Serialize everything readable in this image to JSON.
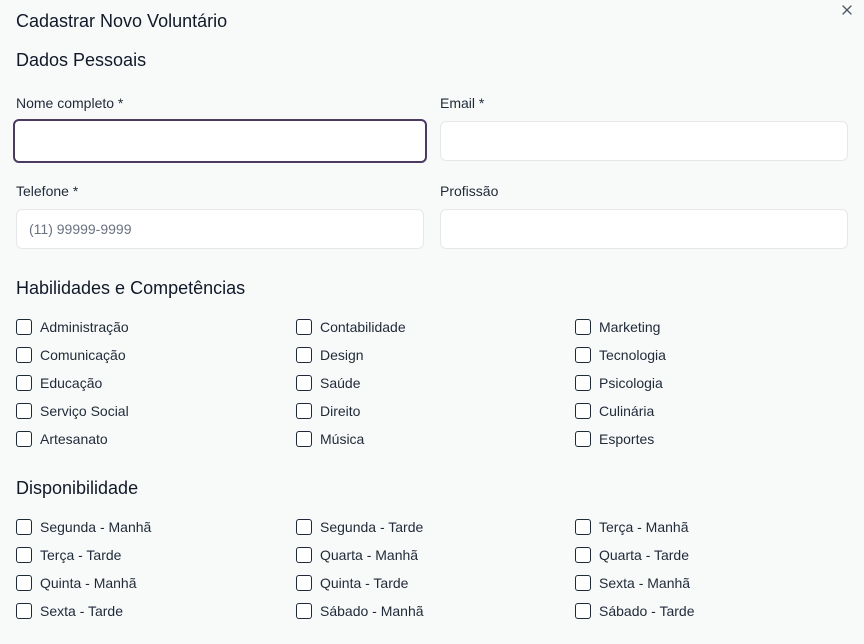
{
  "dialog": {
    "title": "Cadastrar Novo Voluntário",
    "close_symbol": "×"
  },
  "personal": {
    "title": "Dados Pessoais",
    "name_label": "Nome completo *",
    "name_value": "",
    "email_label": "Email *",
    "email_value": "",
    "phone_label": "Telefone *",
    "phone_placeholder": "(11) 99999-9999",
    "profession_label": "Profissão",
    "profession_value": ""
  },
  "skills": {
    "title": "Habilidades e Competências",
    "items": [
      {
        "label": "Administração",
        "checked": false
      },
      {
        "label": "Contabilidade",
        "checked": false
      },
      {
        "label": "Marketing",
        "checked": false
      },
      {
        "label": "Comunicação",
        "checked": false
      },
      {
        "label": "Design",
        "checked": false
      },
      {
        "label": "Tecnologia",
        "checked": false
      },
      {
        "label": "Educação",
        "checked": false
      },
      {
        "label": "Saúde",
        "checked": false
      },
      {
        "label": "Psicologia",
        "checked": false
      },
      {
        "label": "Serviço Social",
        "checked": false
      },
      {
        "label": "Direito",
        "checked": false
      },
      {
        "label": "Culinária",
        "checked": false
      },
      {
        "label": "Artesanato",
        "checked": false
      },
      {
        "label": "Música",
        "checked": false
      },
      {
        "label": "Esportes",
        "checked": false
      }
    ]
  },
  "availability": {
    "title": "Disponibilidade",
    "items": [
      {
        "label": "Segunda - Manhã",
        "checked": false
      },
      {
        "label": "Segunda - Tarde",
        "checked": false
      },
      {
        "label": "Terça - Manhã",
        "checked": false
      },
      {
        "label": "Terça - Tarde",
        "checked": false
      },
      {
        "label": "Quarta - Manhã",
        "checked": false
      },
      {
        "label": "Quarta - Tarde",
        "checked": false
      },
      {
        "label": "Quinta - Manhã",
        "checked": false
      },
      {
        "label": "Quinta - Tarde",
        "checked": false
      },
      {
        "label": "Sexta - Manhã",
        "checked": false
      },
      {
        "label": "Sexta - Tarde",
        "checked": false
      },
      {
        "label": "Sábado - Manhã",
        "checked": false
      },
      {
        "label": "Sábado - Tarde",
        "checked": false
      }
    ]
  },
  "icons": {
    "close": "close-icon",
    "checkbox": "checkbox-icon"
  },
  "colors": {
    "focus_border": "#4c3a63",
    "background": "#f8fafa"
  }
}
